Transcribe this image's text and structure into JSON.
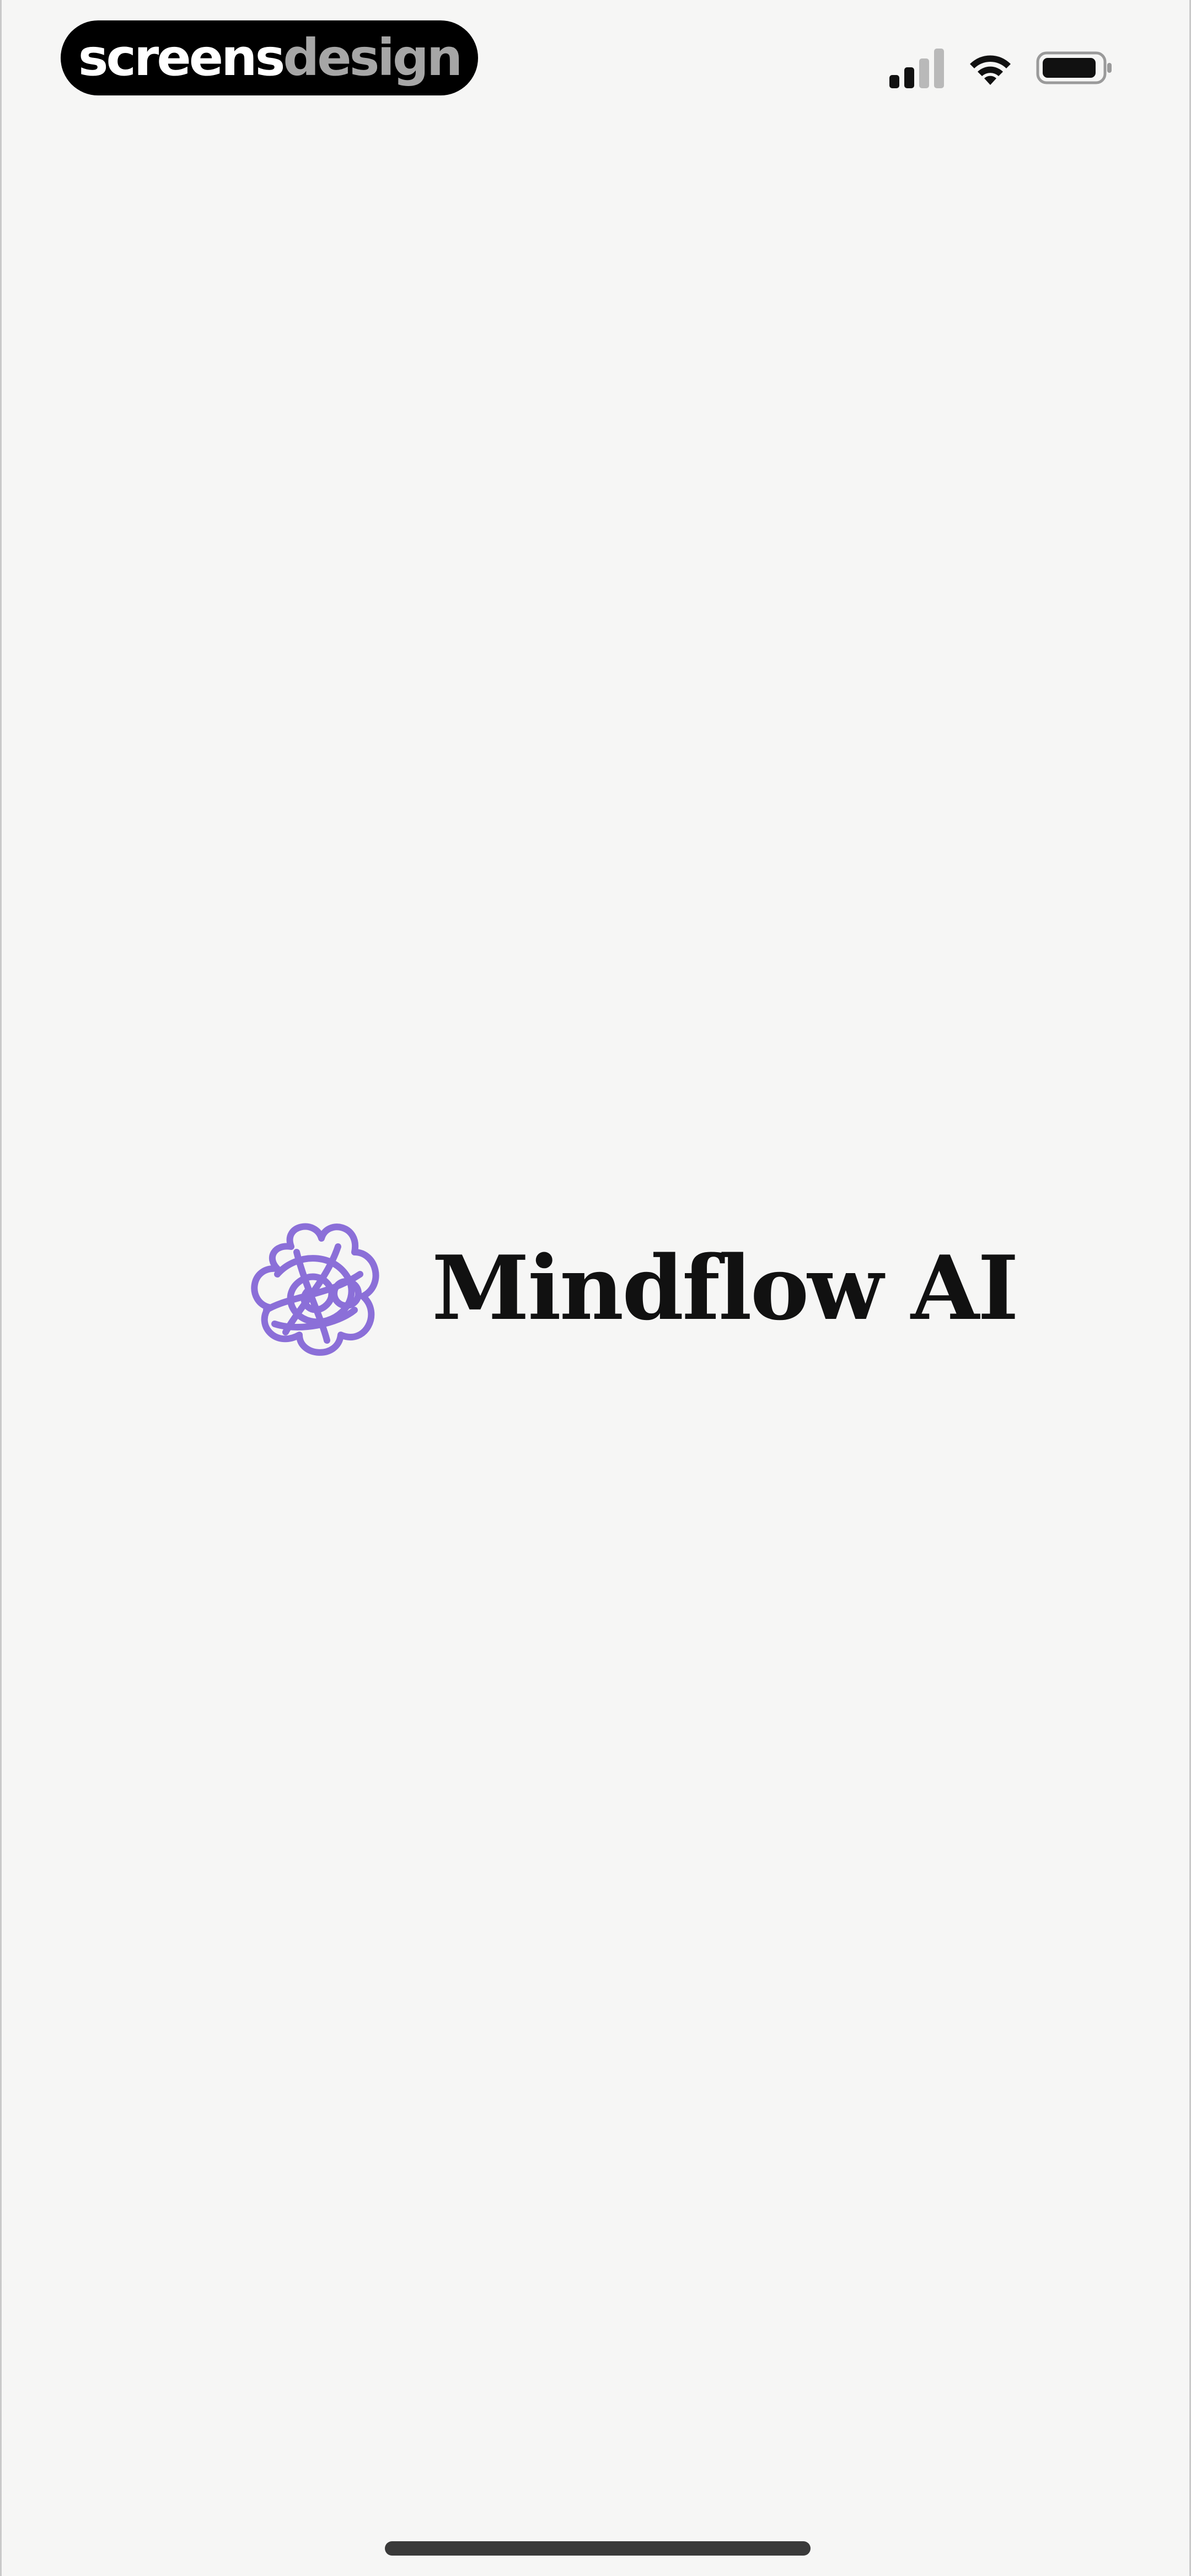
{
  "status_bar": {
    "badge": {
      "part1": "screens",
      "part2": "design"
    },
    "signal_icon": "cellular-signal-icon",
    "wifi_icon": "wifi-icon",
    "battery_icon": "battery-icon"
  },
  "splash": {
    "logo_icon": "mindflow-scribble-logo",
    "app_name": "Mindflow AI",
    "accent_color": "#8b6fd8"
  },
  "home_indicator": "home-indicator"
}
